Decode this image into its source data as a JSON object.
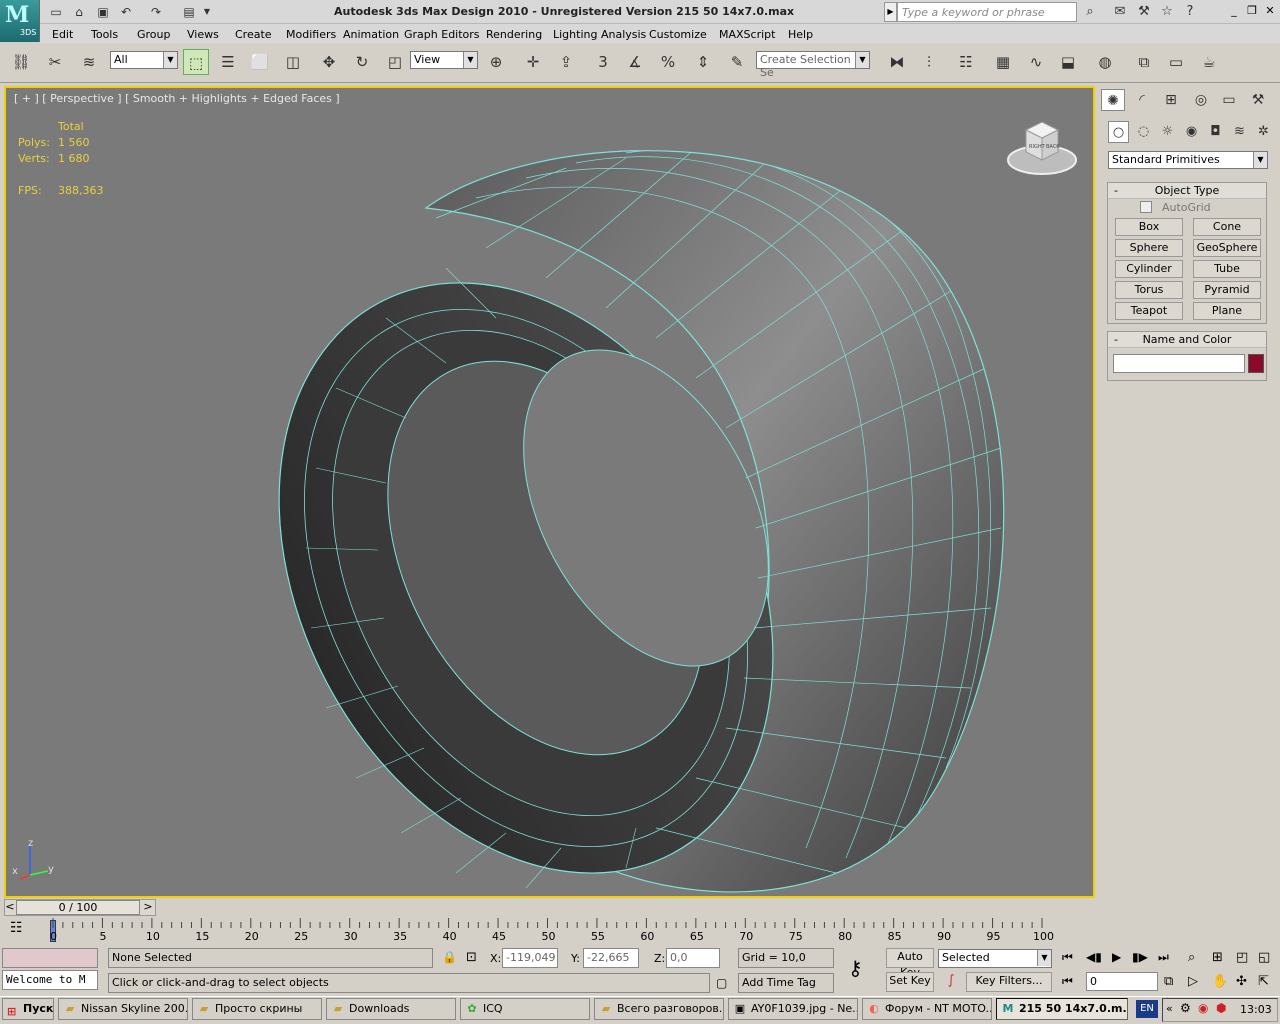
{
  "title": {
    "text": "Autodesk 3ds Max Design 2010   - Unregistered Version     215 50 14x7.0.max",
    "search_placeholder": "Type a keyword or phrase",
    "logo": "3DS"
  },
  "menu": [
    "Edit",
    "Tools",
    "Group",
    "Views",
    "Create",
    "Modifiers",
    "Animation",
    "Graph Editors",
    "Rendering",
    "Lighting Analysis",
    "Customize",
    "MAXScript",
    "Help"
  ],
  "toolbar": {
    "filter": "All",
    "coord": "View",
    "snap_label": "3",
    "percent_label": "%",
    "selection_set_placeholder": "Create Selection Se"
  },
  "viewport": {
    "label": "[ + ] [ Perspective ] [ Smooth + Highlights + Edged Faces ]",
    "stats": {
      "total_label": "Total",
      "polys_label": "Polys:",
      "polys": "1 560",
      "verts_label": "Verts:",
      "verts": "1 680",
      "fps_label": "FPS:",
      "fps": "388,363"
    },
    "axis": {
      "x": "x",
      "y": "y",
      "z": "z"
    },
    "viewcube": {
      "front": "RIGHT",
      "side": "BACK"
    }
  },
  "panel": {
    "category": "Standard Primitives",
    "object_type_title": "Object Type",
    "autogrid": "AutoGrid",
    "buttons": [
      "Box",
      "Cone",
      "Sphere",
      "GeoSphere",
      "Cylinder",
      "Tube",
      "Torus",
      "Pyramid",
      "Teapot",
      "Plane"
    ],
    "name_color_title": "Name and Color",
    "name_value": "",
    "object_color": "#8a0a2a"
  },
  "timeline": {
    "position": "0 / 100",
    "current_frame_fraction": 0,
    "ticks": [
      "0",
      "5",
      "10",
      "15",
      "20",
      "25",
      "30",
      "35",
      "40",
      "45",
      "50",
      "55",
      "60",
      "65",
      "70",
      "75",
      "80",
      "85",
      "90",
      "95",
      "100"
    ]
  },
  "status": {
    "maxscript": "Welcome to M",
    "selection": "None Selected",
    "prompt": "Click or click-and-drag to select objects",
    "x_label": "X:",
    "x": "-119,049",
    "y_label": "Y:",
    "y": "-22,665",
    "z_label": "Z:",
    "z": "0,0",
    "grid": "Grid = 10,0",
    "add_time_tag": "Add Time Tag",
    "auto_key": "Auto Key",
    "set_key": "Set Key",
    "selected": "Selected",
    "key_filters": "Key Filters...",
    "frame": "0"
  },
  "taskbar": {
    "start": "Пуск",
    "tasks": [
      {
        "label": "Nissan Skyline 200...",
        "icon": "folder"
      },
      {
        "label": "Просто скрины",
        "icon": "folder"
      },
      {
        "label": "Downloads",
        "icon": "folder"
      },
      {
        "label": "ICQ",
        "icon": "flower"
      },
      {
        "label": "Всего разговоров...",
        "icon": "folder"
      },
      {
        "label": "AY0F1039.jpg - Ne...",
        "icon": "image"
      },
      {
        "label": "Форум - NT MOTO...",
        "icon": "firefox"
      },
      {
        "label": "215 50 14x7.0.m...",
        "icon": "max"
      }
    ],
    "lang": "EN",
    "clock": "13:03"
  },
  "colors": {
    "viewport_bg": "#7a7a7a",
    "wire": "#7fe0d8",
    "active_border": "#f0d000",
    "stat_text": "#e8d040"
  }
}
